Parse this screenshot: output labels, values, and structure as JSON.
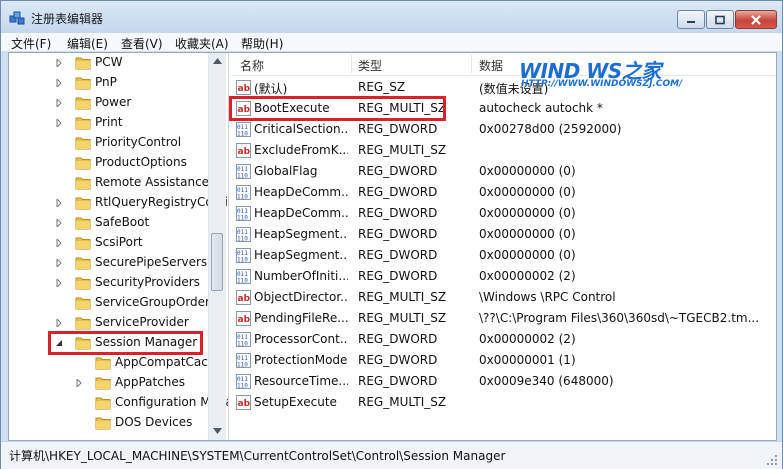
{
  "window": {
    "title": "注册表编辑器"
  },
  "menu": [
    "文件(F)",
    "编辑(E)",
    "查看(V)",
    "收藏夹(A)",
    "帮助(H)"
  ],
  "tree": [
    {
      "label": "PCW",
      "indent": 0,
      "expander": "collapsed"
    },
    {
      "label": "PnP",
      "indent": 0,
      "expander": "collapsed"
    },
    {
      "label": "Power",
      "indent": 0,
      "expander": "collapsed"
    },
    {
      "label": "Print",
      "indent": 0,
      "expander": "collapsed"
    },
    {
      "label": "PriorityControl",
      "indent": 0,
      "expander": "none"
    },
    {
      "label": "ProductOptions",
      "indent": 0,
      "expander": "none"
    },
    {
      "label": "Remote Assistance",
      "indent": 0,
      "expander": "none"
    },
    {
      "label": "RtlQueryRegistryConfig",
      "indent": 0,
      "expander": "collapsed"
    },
    {
      "label": "SafeBoot",
      "indent": 0,
      "expander": "collapsed"
    },
    {
      "label": "ScsiPort",
      "indent": 0,
      "expander": "collapsed"
    },
    {
      "label": "SecurePipeServers",
      "indent": 0,
      "expander": "collapsed"
    },
    {
      "label": "SecurityProviders",
      "indent": 0,
      "expander": "collapsed"
    },
    {
      "label": "ServiceGroupOrder",
      "indent": 0,
      "expander": "none"
    },
    {
      "label": "ServiceProvider",
      "indent": 0,
      "expander": "collapsed"
    },
    {
      "label": "Session Manager",
      "indent": 0,
      "expander": "expanded"
    },
    {
      "label": "AppCompatCache",
      "indent": 1,
      "expander": "none"
    },
    {
      "label": "AppPatches",
      "indent": 1,
      "expander": "collapsed"
    },
    {
      "label": "Configuration Manager",
      "indent": 1,
      "expander": "none"
    },
    {
      "label": "DOS Devices",
      "indent": 1,
      "expander": "none"
    }
  ],
  "columns": {
    "name": "名称",
    "type": "类型",
    "data": "数据"
  },
  "values": [
    {
      "icon": "ab",
      "name": "(默认)",
      "type": "REG_SZ",
      "data": "(数值未设置)"
    },
    {
      "icon": "ab",
      "name": "BootExecute",
      "type": "REG_MULTI_SZ",
      "data": "autocheck autochk *"
    },
    {
      "icon": "bin",
      "name": "CriticalSectionTimeout",
      "type": "REG_DWORD",
      "data": "0x00278d00 (2592000)"
    },
    {
      "icon": "ab",
      "name": "ExcludeFromKnownDlls",
      "type": "REG_MULTI_SZ",
      "data": ""
    },
    {
      "icon": "bin",
      "name": "GlobalFlag",
      "type": "REG_DWORD",
      "data": "0x00000000 (0)"
    },
    {
      "icon": "bin",
      "name": "HeapDeCommitFreeBlockThreshold",
      "type": "REG_DWORD",
      "data": "0x00000000 (0)"
    },
    {
      "icon": "bin",
      "name": "HeapDeCommitTotalFreeThreshold",
      "type": "REG_DWORD",
      "data": "0x00000000 (0)"
    },
    {
      "icon": "bin",
      "name": "HeapSegmentCommit",
      "type": "REG_DWORD",
      "data": "0x00000000 (0)"
    },
    {
      "icon": "bin",
      "name": "HeapSegmentReserve",
      "type": "REG_DWORD",
      "data": "0x00000000 (0)"
    },
    {
      "icon": "bin",
      "name": "NumberOfInitialSessions",
      "type": "REG_DWORD",
      "data": "0x00000002 (2)"
    },
    {
      "icon": "ab",
      "name": "ObjectDirectories",
      "type": "REG_MULTI_SZ",
      "data": "\\Windows \\RPC Control"
    },
    {
      "icon": "ab",
      "name": "PendingFileRenameOperations",
      "type": "REG_MULTI_SZ",
      "data": "\\??\\C:\\Program Files\\360\\360sd\\~TGECB2.tm..."
    },
    {
      "icon": "bin",
      "name": "ProcessorControl",
      "type": "REG_DWORD",
      "data": "0x00000002 (2)"
    },
    {
      "icon": "bin",
      "name": "ProtectionMode",
      "type": "REG_DWORD",
      "data": "0x00000001 (1)"
    },
    {
      "icon": "bin",
      "name": "ResourceTimeoutCount",
      "type": "REG_DWORD",
      "data": "0x0009e340 (648000)"
    },
    {
      "icon": "ab",
      "name": "SetupExecute",
      "type": "REG_MULTI_SZ",
      "data": ""
    }
  ],
  "visible_names": [
    "(默认)",
    "BootExecute",
    "CriticalSection...",
    "ExcludeFromK...",
    "GlobalFlag",
    "HeapDeComm...",
    "HeapDeComm...",
    "HeapSegment...",
    "HeapSegment...",
    "NumberOfIniti...",
    "ObjectDirector...",
    "PendingFileRe...",
    "ProcessorCont...",
    "ProtectionMode",
    "ResourceTime...",
    "SetupExecute"
  ],
  "status": {
    "path": "计算机\\HKEY_LOCAL_MACHINE\\SYSTEM\\CurrentControlSet\\Control\\Session Manager"
  },
  "watermark": {
    "logo": "WIND WS之家",
    "url": "HTTP://WWW.WINDOWSZJ.COM/"
  },
  "colors": {
    "highlight": "#d8232a",
    "folder": "#e8c04a",
    "titlebar": "#c3d8ee"
  }
}
